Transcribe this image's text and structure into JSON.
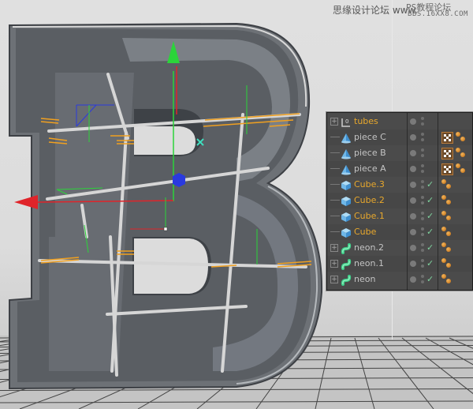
{
  "watermark": {
    "site_cn": "思缘设计论坛 www.",
    "ps_cn": "PS教程论坛",
    "bbs": "BBS.16XX8.COM"
  },
  "viewport": {
    "scene": "3D letter B with neon tube rods",
    "colors": {
      "letter_face": "#5b5f64",
      "letter_side": "#7a7f85",
      "axis_x": "#e0242a",
      "axis_y": "#2bd43a",
      "axis_z": "#2a3adf",
      "selected_highlight": "#f0a020",
      "tube": "#cfcfcf"
    }
  },
  "object_manager": {
    "rows": [
      {
        "name": "tubes",
        "icon": "null-object-icon",
        "expand": true,
        "selected": true,
        "check": false,
        "tags": []
      },
      {
        "name": "piece C",
        "icon": "cone-icon",
        "expand": false,
        "selected": false,
        "check": false,
        "tags": [
          "texture-tag",
          "phong-tag"
        ]
      },
      {
        "name": "piece B",
        "icon": "cone-icon",
        "expand": false,
        "selected": false,
        "check": false,
        "tags": [
          "texture-tag",
          "phong-tag"
        ]
      },
      {
        "name": "piece A",
        "icon": "cone-icon",
        "expand": false,
        "selected": false,
        "check": false,
        "tags": [
          "texture-tag",
          "phong-tag"
        ]
      },
      {
        "name": "Cube.3",
        "icon": "cube-icon",
        "expand": false,
        "selected": true,
        "check": true,
        "tags": [
          "phong-tag"
        ]
      },
      {
        "name": "Cube.2",
        "icon": "cube-icon",
        "expand": false,
        "selected": true,
        "check": true,
        "tags": [
          "phong-tag"
        ]
      },
      {
        "name": "Cube.1",
        "icon": "cube-icon",
        "expand": false,
        "selected": true,
        "check": true,
        "tags": [
          "phong-tag"
        ]
      },
      {
        "name": "Cube",
        "icon": "cube-icon",
        "expand": false,
        "selected": true,
        "check": true,
        "tags": [
          "phong-tag"
        ]
      },
      {
        "name": "neon.2",
        "icon": "sweep-icon",
        "expand": true,
        "selected": false,
        "check": true,
        "tags": [
          "phong-tag"
        ]
      },
      {
        "name": "neon.1",
        "icon": "sweep-icon",
        "expand": true,
        "selected": false,
        "check": true,
        "tags": [
          "phong-tag"
        ]
      },
      {
        "name": "neon",
        "icon": "sweep-icon",
        "expand": true,
        "selected": false,
        "check": true,
        "tags": [
          "phong-tag"
        ]
      }
    ],
    "check_glyph": "✓"
  }
}
